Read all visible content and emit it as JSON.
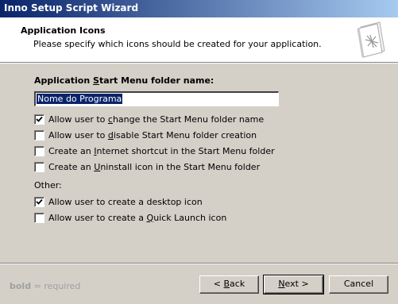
{
  "window": {
    "title": "Inno Setup Script Wizard"
  },
  "header": {
    "title": "Application Icons",
    "subtitle": "Please specify which icons should be created for your application.",
    "icon": "wizard-book-icon"
  },
  "folder": {
    "label_pre": "Application ",
    "label_ul": "S",
    "label_post": "tart Menu folder name:",
    "value": "Nome do Programa"
  },
  "options": [
    {
      "pre": "Allow user to ",
      "ul": "c",
      "post": "hange the Start Menu folder name",
      "checked": true
    },
    {
      "pre": "Allow user to ",
      "ul": "d",
      "post": "isable Start Menu folder creation",
      "checked": false
    },
    {
      "pre": "Create an ",
      "ul": "I",
      "post": "nternet shortcut in the Start Menu folder",
      "checked": false
    },
    {
      "pre": "Create an ",
      "ul": "U",
      "post": "ninstall icon in the Start Menu folder",
      "checked": false
    }
  ],
  "other": {
    "label": "Other:",
    "items": [
      {
        "pre": "Allow user to create a desktop icon",
        "ul": "",
        "post": "",
        "checked": true
      },
      {
        "pre": "Allow user to create a ",
        "ul": "Q",
        "post": "uick Launch icon",
        "checked": false
      }
    ]
  },
  "legend": {
    "bold": "bold",
    "rest": " = required"
  },
  "buttons": {
    "back": {
      "pre": "< ",
      "ul": "B",
      "post": "ack"
    },
    "next": {
      "pre": "",
      "ul": "N",
      "post": "ext >"
    },
    "cancel": "Cancel"
  }
}
